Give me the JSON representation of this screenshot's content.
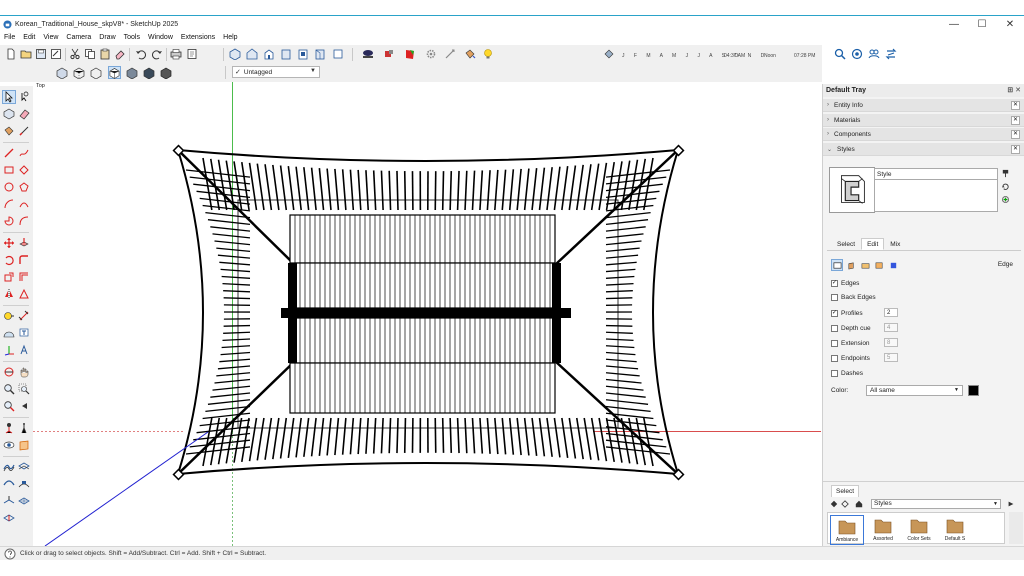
{
  "window": {
    "title": "Korean_Traditional_House_skpV8* - SketchUp 2025",
    "min_glyph": "—",
    "max_glyph": "☐",
    "close_glyph": "✕"
  },
  "menu": [
    "File",
    "Edit",
    "View",
    "Camera",
    "Draw",
    "Tools",
    "Window",
    "Extensions",
    "Help"
  ],
  "tag_dropdown": {
    "value": "Untagged",
    "check": "✓",
    "arrow": "▼"
  },
  "shadow": {
    "months": "J F M A M J J A S O N D",
    "time_start": "04:37 AM",
    "time_noon": "Noon",
    "time_end": "07:28 PM",
    "month_fraction": 0.5,
    "time_fraction": 0.63
  },
  "viewport": {
    "label": "Top"
  },
  "tray": {
    "title": "Default Tray",
    "head_ctrls": "⊞ ✕",
    "sections": [
      {
        "label": "Entity Info",
        "chevron": "›",
        "close": "✕"
      },
      {
        "label": "Materials",
        "chevron": "›",
        "close": "✕"
      },
      {
        "label": "Components",
        "chevron": "›",
        "close": "✕"
      },
      {
        "label": "Styles",
        "chevron": "⌄",
        "close": "✕"
      }
    ],
    "styles": {
      "name": "Style",
      "tabs": [
        "Select",
        "Edit",
        "Mix"
      ],
      "edge_label": "Edge",
      "options": [
        {
          "label": "Edges",
          "checked": true,
          "mark": "✓"
        },
        {
          "label": "Back Edges",
          "checked": false,
          "mark": ""
        },
        {
          "label": "Profiles",
          "checked": true,
          "mark": "✓",
          "value": "2"
        },
        {
          "label": "Depth cue",
          "checked": false,
          "mark": "",
          "value": "4"
        },
        {
          "label": "Extension",
          "checked": false,
          "mark": "",
          "value": "8"
        },
        {
          "label": "Endpoints",
          "checked": false,
          "mark": "",
          "value": "5"
        },
        {
          "label": "Dashes",
          "checked": false,
          "mark": ""
        }
      ],
      "color_label": "Color:",
      "color_value": "All same",
      "color_swatch": "#000000",
      "dropdown_arrow": "▼",
      "lower_tab": "Select",
      "collection": "Styles",
      "collection_arrow": "▼",
      "swatches": [
        "Ambiance",
        "Assorted",
        "Color Sets",
        "Default S"
      ]
    }
  },
  "status": {
    "message": "Click or drag to select objects. Shift = Add/Subtract. Ctrl = Add. Shift + Ctrl = Subtract."
  },
  "colors": {
    "accent": "#2aa3c9",
    "axis_red": "#d02020",
    "axis_green": "#00a000",
    "axis_blue": "#2020d0"
  }
}
